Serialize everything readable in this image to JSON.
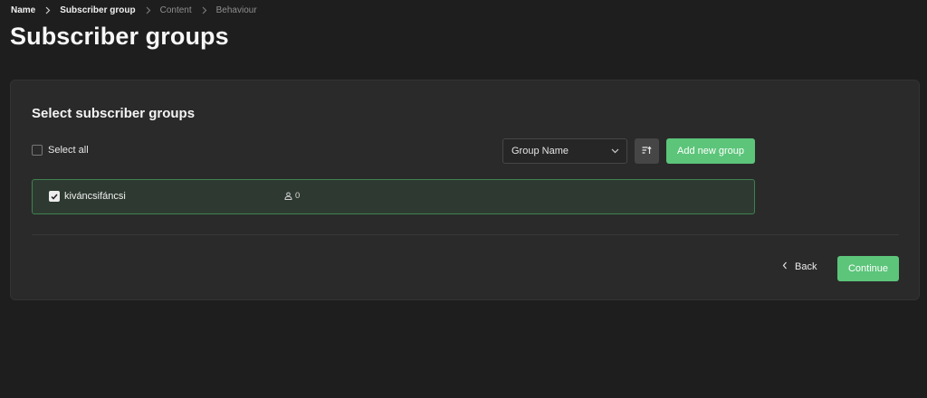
{
  "breadcrumb": {
    "items": [
      {
        "label": "Name",
        "active": true
      },
      {
        "label": "Subscriber group",
        "active": true
      },
      {
        "label": "Content",
        "active": false
      },
      {
        "label": "Behaviour",
        "active": false
      }
    ]
  },
  "page": {
    "title": "Subscriber groups"
  },
  "card": {
    "title": "Select subscriber groups",
    "select_all_label": "Select all",
    "select_all_checked": false,
    "sort_dropdown": {
      "selected": "Group Name",
      "icon": "chevron-down-icon"
    },
    "sort_order_icon": "sort-ascending-icon",
    "add_group_label": "Add new group",
    "groups": [
      {
        "name": "kiváncsifáncsi",
        "subscriber_count": "0",
        "checked": true
      }
    ]
  },
  "footer": {
    "back_label": "Back",
    "continue_label": "Continue"
  },
  "colors": {
    "accent": "#5cc57a",
    "background": "#1e1e1e",
    "card": "#2a2a2a",
    "selected_row_border": "#3e8151"
  }
}
